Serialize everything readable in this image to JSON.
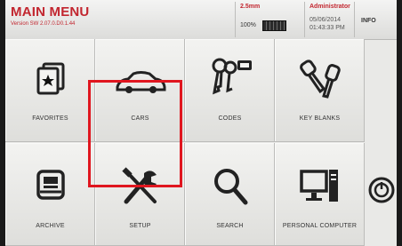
{
  "header": {
    "title": "MAIN MENU",
    "version": "Version SW 2.07.0.D0.1.44",
    "cut_value": "2.5mm",
    "zoom": "100%",
    "user": "Administrator",
    "date": "05/06/2014",
    "time": "01:43:33 PM",
    "info_label": "INFO"
  },
  "menu": {
    "favorites": "FAVORITES",
    "cars": "CARS",
    "codes": "CODES",
    "key_blanks": "KEY BLANKS",
    "archive": "ARCHIVE",
    "setup": "SETUP",
    "search": "SEARCH",
    "personal_computer": "PERSONAL COMPUTER"
  },
  "icons": {
    "favorites": "star-card-icon",
    "cars": "car-icon",
    "codes": "keys-tag-icon",
    "key_blanks": "key-blanks-icon",
    "archive": "archive-tray-icon",
    "setup": "tools-icon",
    "search": "magnifier-icon",
    "personal_computer": "computer-icon",
    "power": "power-icon"
  },
  "colors": {
    "accent": "#c2262f",
    "highlight": "#e0161f"
  }
}
